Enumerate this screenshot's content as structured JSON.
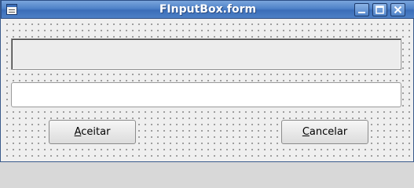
{
  "window": {
    "title": "FInputBox.form"
  },
  "form": {
    "prompt_text": "",
    "input_value": "",
    "ok_button": {
      "mnemonic": "A",
      "rest": "ceitar"
    },
    "cancel_button": {
      "mnemonic": "C",
      "rest": "ancelar"
    }
  },
  "icons": {
    "app": "form-window-icon",
    "minimize": "minimize-icon",
    "maximize": "maximize-icon",
    "close": "close-icon"
  },
  "colors": {
    "titlebar": "#4f82c8",
    "client_background": "#efefef",
    "input_background": "#ffffff"
  }
}
